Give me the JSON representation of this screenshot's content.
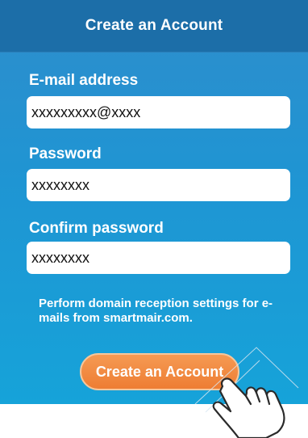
{
  "header": {
    "title": "Create an Account"
  },
  "form": {
    "email": {
      "label": "E-mail address",
      "value": "xxxxxxxxx@xxxx"
    },
    "password": {
      "label": "Password",
      "value": "xxxxxxxx"
    },
    "confirm_password": {
      "label": "Confirm password",
      "value": "xxxxxxxx"
    },
    "note": "Perform domain reception settings for e-mails from smartmair.com."
  },
  "submit": {
    "label": "Create an Account"
  },
  "colors": {
    "header_bg": "#1c6ea8",
    "screen_bg": "#1f95d3",
    "button_orange": "#ee7d33"
  },
  "icons": [
    "pointing-hand-icon"
  ]
}
